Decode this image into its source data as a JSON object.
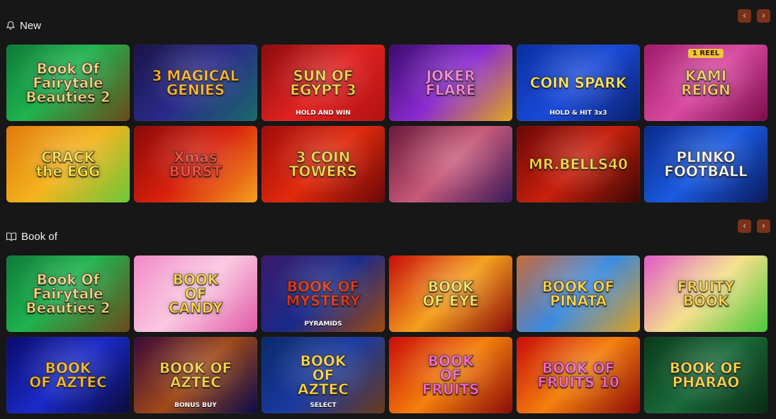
{
  "sections": [
    {
      "title": "New",
      "icon": "bell-icon",
      "games": [
        {
          "title": "Book Of\nFairytale\nBeauties 2",
          "bg": "linear-gradient(135deg,#0e7a3a,#1fb34e 45%,#6b4a1c)",
          "color": "#f6d27a"
        },
        {
          "title": "3 MAGICAL\nGENIES",
          "bg": "linear-gradient(135deg,#1a1446,#2a2a8a 50%,#1a6a6a)",
          "color": "#ffb21e"
        },
        {
          "title": "SUN OF\nEGYPT 3",
          "sub": "HOLD AND WIN",
          "bg": "linear-gradient(135deg,#8a0c0c,#e02222 50%,#b31212)",
          "color": "#ffcf3a"
        },
        {
          "title": "JOKER\nFLARE",
          "bg": "linear-gradient(135deg,#3a0c6a,#8a2ad1 50%,#e0a81c)",
          "color": "#ff7ad8"
        },
        {
          "title": "COIN SPARK",
          "sub": "HOLD & HIT 3x3",
          "bg": "linear-gradient(135deg,#0b2fa0,#1a4ad8 50%,#0a1f6a)",
          "color": "#ffe45a"
        },
        {
          "title": "KAMI\nREIGN",
          "badge": "1 REEL",
          "bg": "linear-gradient(135deg,#a01a6a,#d84aa0 50%,#7a0c4a)",
          "color": "#f8c85a"
        },
        {
          "title": "CRACK\nthe EGG",
          "bg": "linear-gradient(135deg,#e07a0c,#f4b41e 50%,#6ac83a)",
          "color": "#ffe23a"
        },
        {
          "title": "Xmas\nBURST",
          "bg": "linear-gradient(135deg,#8a0a0a,#d8200c 50%,#f4a01e)",
          "color": "#ff3a2a"
        },
        {
          "title": "3 COIN\nTOWERS",
          "bg": "linear-gradient(135deg,#a00c0c,#e02a0c 50%,#6a0808)",
          "color": "#ffd23a"
        },
        {
          "title": "",
          "bg": "linear-gradient(135deg,#6a1a3a,#c85a7a 50%,#3a1a5a)",
          "color": "#ffffff"
        },
        {
          "title": "MR.BELLS40",
          "bg": "linear-gradient(135deg,#6a0808,#c8200c 50%,#3a0606)",
          "color": "#ffd23a"
        },
        {
          "title": "PLINKO\nFOOTBALL",
          "bg": "linear-gradient(135deg,#0a2a8a,#1a5ae0 50%,#0a1a5a)",
          "color": "#ffffff"
        }
      ]
    },
    {
      "title": "Book of",
      "icon": "book-icon",
      "games": [
        {
          "title": "Book Of\nFairytale\nBeauties 2",
          "bg": "linear-gradient(135deg,#0e7a3a,#1fb34e 45%,#6b4a1c)",
          "color": "#f6d27a"
        },
        {
          "title": "BOOK\nOF\nCANDY",
          "bg": "linear-gradient(135deg,#f08ac8,#fbc8e0 50%,#e05aa8)",
          "color": "#ffd23a"
        },
        {
          "title": "BOOK OF\nMYSTERY",
          "sub": "PYRAMIDS",
          "bg": "linear-gradient(135deg,#3a1a6a,#1a2a8a 50%,#a04a0c)",
          "color": "#e02a0c"
        },
        {
          "title": "BOOK\nOF EYE",
          "bg": "linear-gradient(135deg,#c80c0c,#f4a01e 50%,#8a0a0a)",
          "color": "#ffe45a"
        },
        {
          "title": "BOOK OF\nPIÑATA",
          "bg": "linear-gradient(135deg,#c86a3a,#3a8ae0 50%,#e0a01e)",
          "color": "#ffd23a"
        },
        {
          "title": "FRUITY\nBOOK",
          "bg": "linear-gradient(135deg,#e05ac8,#f4e08a 50%,#4ac83a)",
          "color": "#ffd23a"
        },
        {
          "title": "BOOK\nOF AZTEC",
          "bg": "linear-gradient(135deg,#0a0a6a,#1a2ac8 50%,#0a0a3a)",
          "color": "#f4b41e"
        },
        {
          "title": "BOOK OF\nAZTEC",
          "sub": "BONUS BUY",
          "bg": "linear-gradient(135deg,#3a0a3a,#a04a1a 50%,#0a0a4a)",
          "color": "#ffd23a"
        },
        {
          "title": "BOOK\nOF\nAZTEC",
          "sub": "SELECT",
          "bg": "linear-gradient(135deg,#0a2a6a,#1a3aa0 50%,#6a3a1a)",
          "color": "#ffd23a"
        },
        {
          "title": "BOOK\nOF\nFRUITS",
          "bg": "linear-gradient(135deg,#c80c0c,#f4800c 50%,#8a0a0a)",
          "color": "#ff5ac8"
        },
        {
          "title": "BOOK OF\nFRUITS 10",
          "bg": "linear-gradient(135deg,#c80c0c,#f4800c 50%,#8a0a0a)",
          "color": "#ff5ac8"
        },
        {
          "title": "BOOK OF\nPHARAO",
          "bg": "linear-gradient(135deg,#0a3a1a,#1a6a3a 50%,#0a2a12)",
          "color": "#ffd23a"
        }
      ]
    }
  ],
  "nav": {
    "prev_label": "‹",
    "next_label": "›"
  }
}
